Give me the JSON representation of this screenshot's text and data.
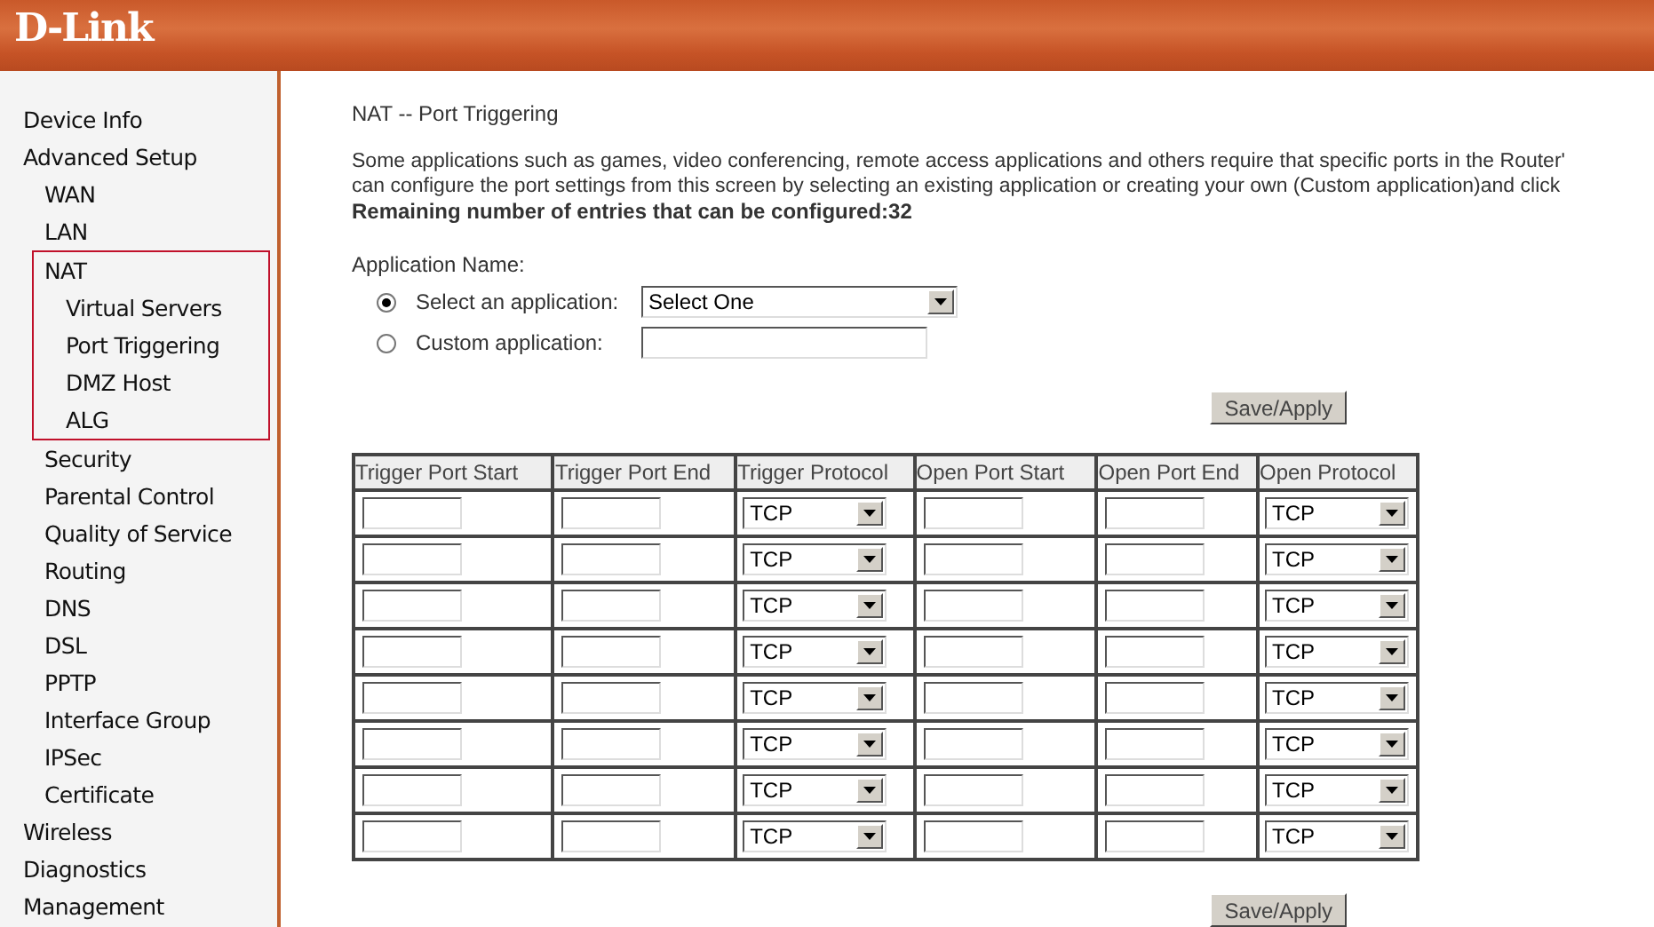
{
  "header": {
    "logo": "D-Link"
  },
  "sidebar": {
    "items": [
      {
        "label": "Device Info"
      },
      {
        "label": "Advanced Setup",
        "children": [
          {
            "label": "WAN"
          },
          {
            "label": "LAN"
          },
          {
            "label": "NAT",
            "highlighted": true,
            "children": [
              {
                "label": "Virtual Servers"
              },
              {
                "label": "Port Triggering"
              },
              {
                "label": "DMZ Host"
              },
              {
                "label": "ALG"
              }
            ]
          },
          {
            "label": "Security"
          },
          {
            "label": "Parental Control"
          },
          {
            "label": "Quality of Service"
          },
          {
            "label": "Routing"
          },
          {
            "label": "DNS"
          },
          {
            "label": "DSL"
          },
          {
            "label": "PPTP"
          },
          {
            "label": "Interface Group"
          },
          {
            "label": "IPSec"
          },
          {
            "label": "Certificate"
          }
        ]
      },
      {
        "label": "Wireless"
      },
      {
        "label": "Diagnostics"
      },
      {
        "label": "Management"
      }
    ]
  },
  "page": {
    "title": "NAT -- Port Triggering",
    "description": [
      "Some applications such as games, video conferencing, remote access applications and others require that specific ports in the Router'",
      "can configure the port settings from this screen by selecting an existing application or creating your own (Custom application)and click"
    ],
    "remaining": "Remaining number of entries that can be configured:32",
    "application_name_label": "Application Name:",
    "options": [
      {
        "kind": "select",
        "label": "Select an application:",
        "value": "Select One",
        "selected": true
      },
      {
        "kind": "text",
        "label": "Custom application:",
        "selected": false
      }
    ],
    "save_button": "Save/Apply",
    "table": {
      "columns": [
        "Trigger Port Start",
        "Trigger Port End",
        "Trigger Protocol",
        "Open Port Start",
        "Open Port End",
        "Open Protocol"
      ],
      "rows": [
        {
          "trigger_protocol": "TCP",
          "open_protocol": "TCP"
        },
        {
          "trigger_protocol": "TCP",
          "open_protocol": "TCP"
        },
        {
          "trigger_protocol": "TCP",
          "open_protocol": "TCP"
        },
        {
          "trigger_protocol": "TCP",
          "open_protocol": "TCP"
        },
        {
          "trigger_protocol": "TCP",
          "open_protocol": "TCP"
        },
        {
          "trigger_protocol": "TCP",
          "open_protocol": "TCP"
        },
        {
          "trigger_protocol": "TCP",
          "open_protocol": "TCP"
        },
        {
          "trigger_protocol": "TCP",
          "open_protocol": "TCP"
        }
      ]
    },
    "bottom_save_button": "Save/Apply"
  }
}
